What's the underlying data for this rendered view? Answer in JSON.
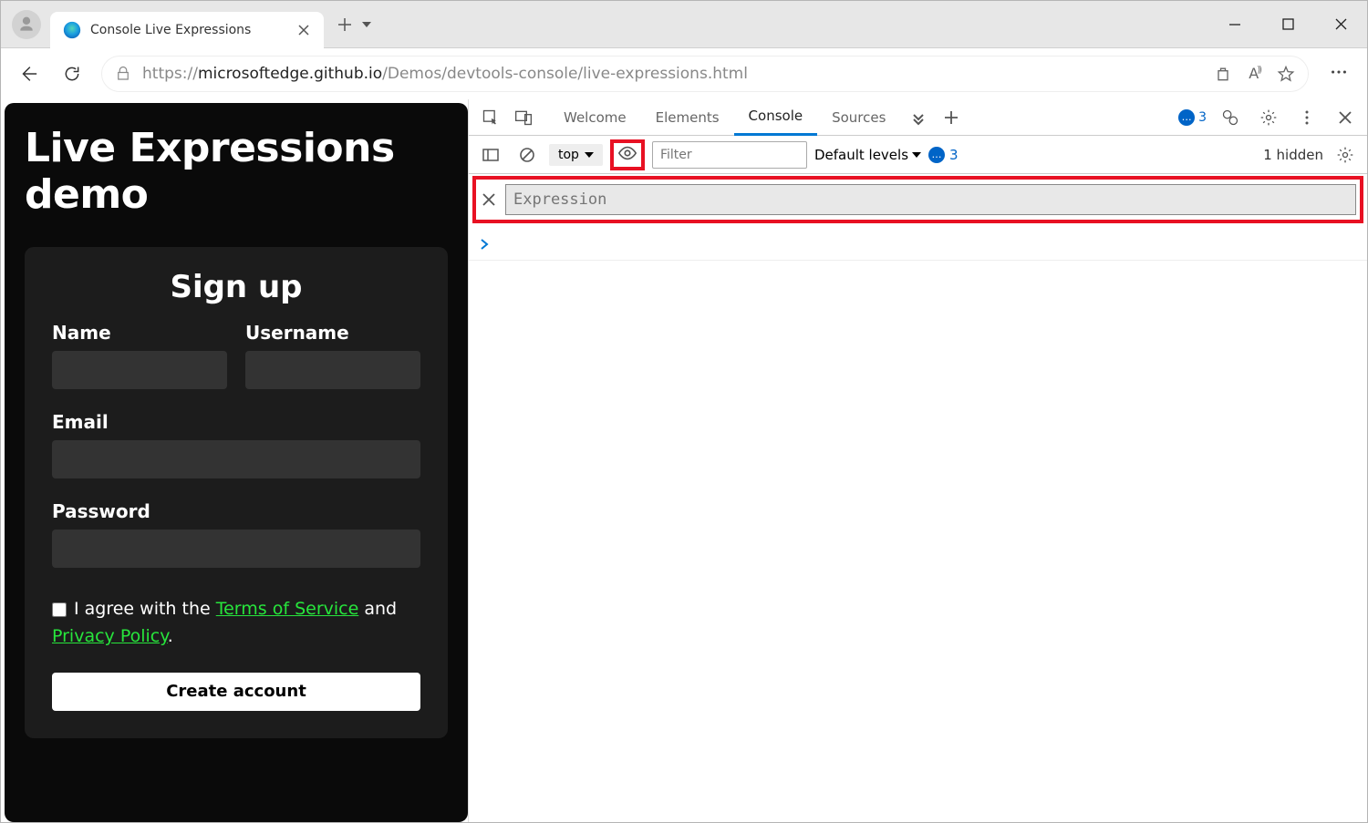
{
  "window": {
    "tab_title": "Console Live Expressions",
    "url_prefix": "https://",
    "url_main": "microsoftedge.github.io",
    "url_rest": "/Demos/devtools-console/live-expressions.html"
  },
  "page": {
    "heading": "Live Expressions demo",
    "form_title": "Sign up",
    "labels": {
      "name": "Name",
      "username": "Username",
      "email": "Email",
      "password": "Password"
    },
    "consent_pre": "I agree with the ",
    "consent_tos": "Terms of Service",
    "consent_mid": " and ",
    "consent_privacy": "Privacy Policy",
    "consent_post": ".",
    "submit": "Create account"
  },
  "devtools": {
    "tabs": {
      "welcome": "Welcome",
      "elements": "Elements",
      "console": "Console",
      "sources": "Sources"
    },
    "top_badge_count": "3",
    "context": "top",
    "filter_placeholder": "Filter",
    "levels": "Default levels",
    "issues_count": "3",
    "hidden_text": "1 hidden",
    "expression_placeholder": "Expression"
  }
}
